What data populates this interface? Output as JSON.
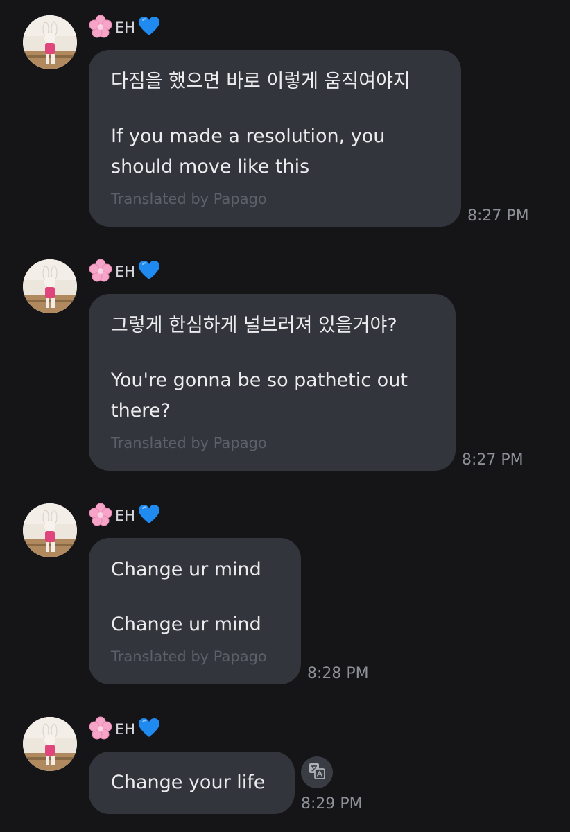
{
  "messages": [
    {
      "sender": "EH",
      "original": "다짐을 했으면 바로 이렇게 움직여야지",
      "translation": "If you made a resolution, you\nshould move like this",
      "credit": "Translated by Papago",
      "time": "8:27 PM"
    },
    {
      "sender": "EH",
      "original": "그렇게 한심하게 널브러져 있을거야?",
      "translation": "You're gonna be so pathetic out\nthere?",
      "credit": "Translated by Papago",
      "time": "8:27 PM"
    },
    {
      "sender": "EH",
      "original": "Change ur mind",
      "translation": "Change ur mind",
      "credit": "Translated by Papago",
      "time": "8:28 PM"
    },
    {
      "sender": "EH",
      "original": "Change your life",
      "time": "8:29 PM"
    }
  ]
}
